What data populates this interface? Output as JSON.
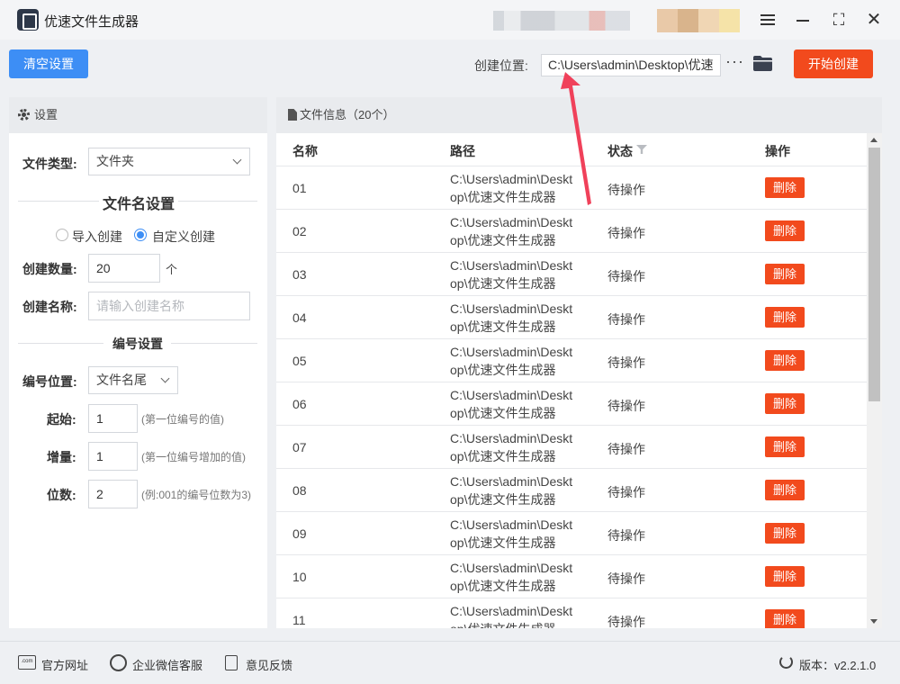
{
  "app": {
    "title": "优速文件生成器"
  },
  "window_controls": {
    "menu": "menu-icon",
    "minimize": "minimize-icon",
    "maximize": "maximize-icon",
    "close": "close-icon"
  },
  "toolbar": {
    "clear_label": "清空设置",
    "location_label": "创建位置:",
    "location_value": "C:\\Users\\admin\\Desktop\\优速",
    "more_label": "···",
    "start_label": "开始创建"
  },
  "settings": {
    "header": "设置",
    "file_type_label": "文件类型:",
    "file_type_value": "文件夹",
    "filename_section": "文件名设置",
    "radio_import": "导入创建",
    "radio_custom": "自定义创建",
    "radio_selected": "custom",
    "count_label": "创建数量:",
    "count_value": "20",
    "count_unit": "个",
    "name_label": "创建名称:",
    "name_placeholder": "请输入创建名称",
    "numbering_section": "编号设置",
    "num_pos_label": "编号位置:",
    "num_pos_value": "文件名尾",
    "start_label": "起始:",
    "start_value": "1",
    "start_hint": "(第一位编号的值)",
    "inc_label": "增量:",
    "inc_value": "1",
    "inc_hint": "(第一位编号增加的值)",
    "digits_label": "位数:",
    "digits_value": "2",
    "digits_hint": "(例:001的编号位数为3)"
  },
  "files": {
    "header": "文件信息（20个）",
    "columns": {
      "name": "名称",
      "path": "路径",
      "status": "状态",
      "action": "操作"
    },
    "rows": [
      {
        "name": "01",
        "path": "C:\\Users\\admin\\Desktop\\优速文件生成器",
        "status": "待操作",
        "action": "删除"
      },
      {
        "name": "02",
        "path": "C:\\Users\\admin\\Desktop\\优速文件生成器",
        "status": "待操作",
        "action": "删除"
      },
      {
        "name": "03",
        "path": "C:\\Users\\admin\\Desktop\\优速文件生成器",
        "status": "待操作",
        "action": "删除"
      },
      {
        "name": "04",
        "path": "C:\\Users\\admin\\Desktop\\优速文件生成器",
        "status": "待操作",
        "action": "删除"
      },
      {
        "name": "05",
        "path": "C:\\Users\\admin\\Desktop\\优速文件生成器",
        "status": "待操作",
        "action": "删除"
      },
      {
        "name": "06",
        "path": "C:\\Users\\admin\\Desktop\\优速文件生成器",
        "status": "待操作",
        "action": "删除"
      },
      {
        "name": "07",
        "path": "C:\\Users\\admin\\Desktop\\优速文件生成器",
        "status": "待操作",
        "action": "删除"
      },
      {
        "name": "08",
        "path": "C:\\Users\\admin\\Desktop\\优速文件生成器",
        "status": "待操作",
        "action": "删除"
      },
      {
        "name": "09",
        "path": "C:\\Users\\admin\\Desktop\\优速文件生成器",
        "status": "待操作",
        "action": "删除"
      },
      {
        "name": "10",
        "path": "C:\\Users\\admin\\Desktop\\优速文件生成器",
        "status": "待操作",
        "action": "删除"
      },
      {
        "name": "11",
        "path": "C:\\Users\\admin\\Desktop\\优速文件生成器",
        "status": "待操作",
        "action": "删除"
      }
    ]
  },
  "footer": {
    "website_label": "官方网址",
    "website_icon_text": ".com",
    "wechat_label": "企业微信客服",
    "feedback_label": "意见反馈",
    "version_label": "版本：v2.2.1.0"
  },
  "colors": {
    "primary": "#3d8ef5",
    "danger": "#f24a1d",
    "arrow": "#f0415a"
  }
}
